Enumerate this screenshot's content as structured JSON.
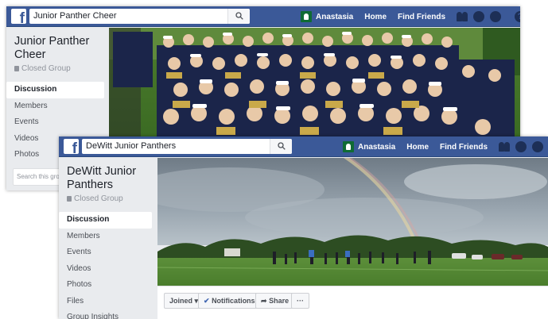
{
  "screen1": {
    "search_query": "Junior Panther Cheer",
    "nav": {
      "user": "Anastasia",
      "home": "Home",
      "find_friends": "Find Friends"
    },
    "group_name": "Junior Panther Cheer",
    "group_type": "Closed Group",
    "menu": [
      "Discussion",
      "Members",
      "Events",
      "Videos",
      "Photos"
    ],
    "search_group_placeholder": "Search this group",
    "cover_photo": "cheerleaders-team-photo"
  },
  "screen2": {
    "search_query": "DeWitt Junior Panthers",
    "nav": {
      "user": "Anastasia",
      "home": "Home",
      "find_friends": "Find Friends"
    },
    "group_name": "DeWitt Junior Panthers",
    "group_type": "Closed Group",
    "menu": [
      "Discussion",
      "Members",
      "Events",
      "Videos",
      "Photos",
      "Files",
      "Group Insights"
    ],
    "cover_photo": "football-field-rainbow",
    "actions": {
      "joined": "Joined",
      "notifications": "Notifications",
      "share": "Share",
      "more": "···"
    }
  },
  "colors": {
    "facebook_blue": "#3b5998",
    "page_bg": "#e9ebee",
    "link_blue": "#4267b2"
  }
}
